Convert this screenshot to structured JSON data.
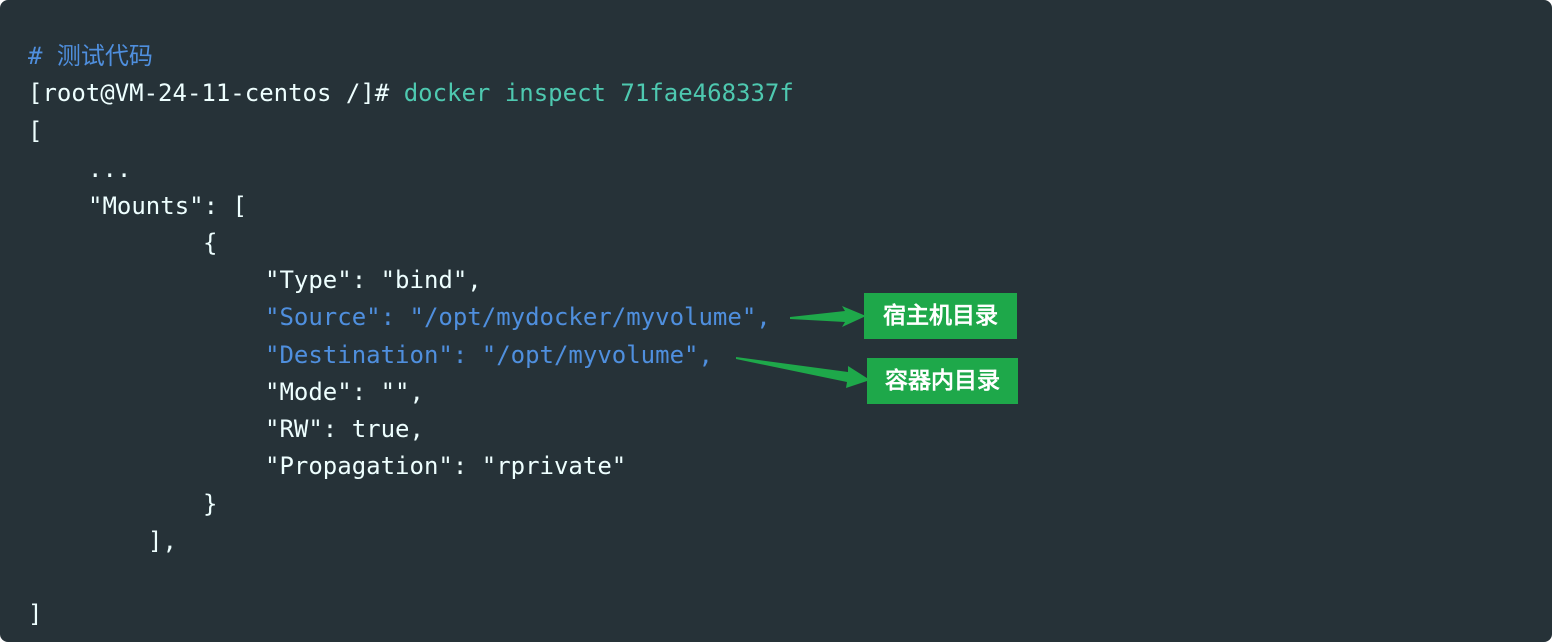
{
  "code": {
    "comment": "# 测试代码",
    "prompt": "[root@VM-24-11-centos /]# ",
    "command": "docker inspect 71fae468337f",
    "open_bracket": "[",
    "ellipsis": "...",
    "mounts_line": "\"Mounts\": [",
    "open_brace": "{",
    "type_line": "\"Type\": \"bind\",",
    "source_line": "\"Source\": \"/opt/mydocker/myvolume\",",
    "destination_line": "\"Destination\": \"/opt/myvolume\",",
    "mode_line": "\"Mode\": \"\",",
    "rw_line": "\"RW\": true,",
    "propagation_line": "\"Propagation\": \"rprivate\"",
    "close_brace": "}",
    "close_mounts": "],",
    "close_bracket": "]"
  },
  "annotations": {
    "source_label": "宿主机目录",
    "destination_label": "容器内目录"
  },
  "colors": {
    "background": "#263238",
    "text": "#eeffff",
    "comment": "#4f8fde",
    "command": "#4ec9b0",
    "highlight": "#4f8fde",
    "callout": "#1ea84a"
  }
}
